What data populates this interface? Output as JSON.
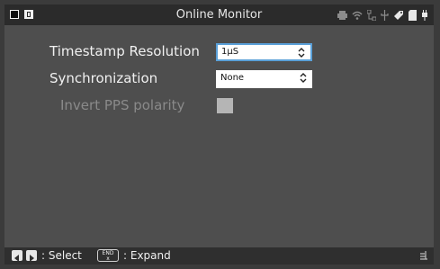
{
  "topbar": {
    "title": "Online Monitor",
    "status_icons": [
      "printer-icon",
      "wifi-icon",
      "network-icon",
      "usb-icon",
      "tag-icon",
      "sd-card-icon",
      "plug-icon"
    ]
  },
  "settings": {
    "timestamp_resolution": {
      "label": "Timestamp Resolution",
      "value": "1µS"
    },
    "synchronization": {
      "label": "Synchronization",
      "value": "None"
    },
    "invert_pps": {
      "label": "Invert PPS polarity",
      "checked": false
    }
  },
  "bottombar": {
    "select_hint": ": Select",
    "end_key_label": "END",
    "end_key_sub": "x",
    "expand_hint": ": Expand"
  }
}
